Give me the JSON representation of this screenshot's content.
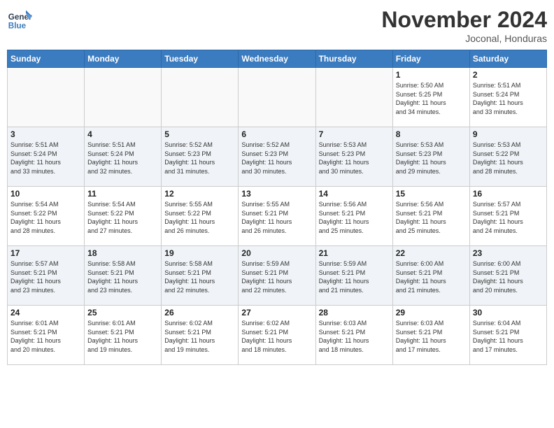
{
  "header": {
    "logo_line1": "General",
    "logo_line2": "Blue",
    "month": "November 2024",
    "location": "Joconal, Honduras"
  },
  "weekdays": [
    "Sunday",
    "Monday",
    "Tuesday",
    "Wednesday",
    "Thursday",
    "Friday",
    "Saturday"
  ],
  "weeks": [
    [
      {
        "day": "",
        "info": ""
      },
      {
        "day": "",
        "info": ""
      },
      {
        "day": "",
        "info": ""
      },
      {
        "day": "",
        "info": ""
      },
      {
        "day": "",
        "info": ""
      },
      {
        "day": "1",
        "info": "Sunrise: 5:50 AM\nSunset: 5:25 PM\nDaylight: 11 hours\nand 34 minutes."
      },
      {
        "day": "2",
        "info": "Sunrise: 5:51 AM\nSunset: 5:24 PM\nDaylight: 11 hours\nand 33 minutes."
      }
    ],
    [
      {
        "day": "3",
        "info": "Sunrise: 5:51 AM\nSunset: 5:24 PM\nDaylight: 11 hours\nand 33 minutes."
      },
      {
        "day": "4",
        "info": "Sunrise: 5:51 AM\nSunset: 5:24 PM\nDaylight: 11 hours\nand 32 minutes."
      },
      {
        "day": "5",
        "info": "Sunrise: 5:52 AM\nSunset: 5:23 PM\nDaylight: 11 hours\nand 31 minutes."
      },
      {
        "day": "6",
        "info": "Sunrise: 5:52 AM\nSunset: 5:23 PM\nDaylight: 11 hours\nand 30 minutes."
      },
      {
        "day": "7",
        "info": "Sunrise: 5:53 AM\nSunset: 5:23 PM\nDaylight: 11 hours\nand 30 minutes."
      },
      {
        "day": "8",
        "info": "Sunrise: 5:53 AM\nSunset: 5:23 PM\nDaylight: 11 hours\nand 29 minutes."
      },
      {
        "day": "9",
        "info": "Sunrise: 5:53 AM\nSunset: 5:22 PM\nDaylight: 11 hours\nand 28 minutes."
      }
    ],
    [
      {
        "day": "10",
        "info": "Sunrise: 5:54 AM\nSunset: 5:22 PM\nDaylight: 11 hours\nand 28 minutes."
      },
      {
        "day": "11",
        "info": "Sunrise: 5:54 AM\nSunset: 5:22 PM\nDaylight: 11 hours\nand 27 minutes."
      },
      {
        "day": "12",
        "info": "Sunrise: 5:55 AM\nSunset: 5:22 PM\nDaylight: 11 hours\nand 26 minutes."
      },
      {
        "day": "13",
        "info": "Sunrise: 5:55 AM\nSunset: 5:21 PM\nDaylight: 11 hours\nand 26 minutes."
      },
      {
        "day": "14",
        "info": "Sunrise: 5:56 AM\nSunset: 5:21 PM\nDaylight: 11 hours\nand 25 minutes."
      },
      {
        "day": "15",
        "info": "Sunrise: 5:56 AM\nSunset: 5:21 PM\nDaylight: 11 hours\nand 25 minutes."
      },
      {
        "day": "16",
        "info": "Sunrise: 5:57 AM\nSunset: 5:21 PM\nDaylight: 11 hours\nand 24 minutes."
      }
    ],
    [
      {
        "day": "17",
        "info": "Sunrise: 5:57 AM\nSunset: 5:21 PM\nDaylight: 11 hours\nand 23 minutes."
      },
      {
        "day": "18",
        "info": "Sunrise: 5:58 AM\nSunset: 5:21 PM\nDaylight: 11 hours\nand 23 minutes."
      },
      {
        "day": "19",
        "info": "Sunrise: 5:58 AM\nSunset: 5:21 PM\nDaylight: 11 hours\nand 22 minutes."
      },
      {
        "day": "20",
        "info": "Sunrise: 5:59 AM\nSunset: 5:21 PM\nDaylight: 11 hours\nand 22 minutes."
      },
      {
        "day": "21",
        "info": "Sunrise: 5:59 AM\nSunset: 5:21 PM\nDaylight: 11 hours\nand 21 minutes."
      },
      {
        "day": "22",
        "info": "Sunrise: 6:00 AM\nSunset: 5:21 PM\nDaylight: 11 hours\nand 21 minutes."
      },
      {
        "day": "23",
        "info": "Sunrise: 6:00 AM\nSunset: 5:21 PM\nDaylight: 11 hours\nand 20 minutes."
      }
    ],
    [
      {
        "day": "24",
        "info": "Sunrise: 6:01 AM\nSunset: 5:21 PM\nDaylight: 11 hours\nand 20 minutes."
      },
      {
        "day": "25",
        "info": "Sunrise: 6:01 AM\nSunset: 5:21 PM\nDaylight: 11 hours\nand 19 minutes."
      },
      {
        "day": "26",
        "info": "Sunrise: 6:02 AM\nSunset: 5:21 PM\nDaylight: 11 hours\nand 19 minutes."
      },
      {
        "day": "27",
        "info": "Sunrise: 6:02 AM\nSunset: 5:21 PM\nDaylight: 11 hours\nand 18 minutes."
      },
      {
        "day": "28",
        "info": "Sunrise: 6:03 AM\nSunset: 5:21 PM\nDaylight: 11 hours\nand 18 minutes."
      },
      {
        "day": "29",
        "info": "Sunrise: 6:03 AM\nSunset: 5:21 PM\nDaylight: 11 hours\nand 17 minutes."
      },
      {
        "day": "30",
        "info": "Sunrise: 6:04 AM\nSunset: 5:21 PM\nDaylight: 11 hours\nand 17 minutes."
      }
    ]
  ]
}
